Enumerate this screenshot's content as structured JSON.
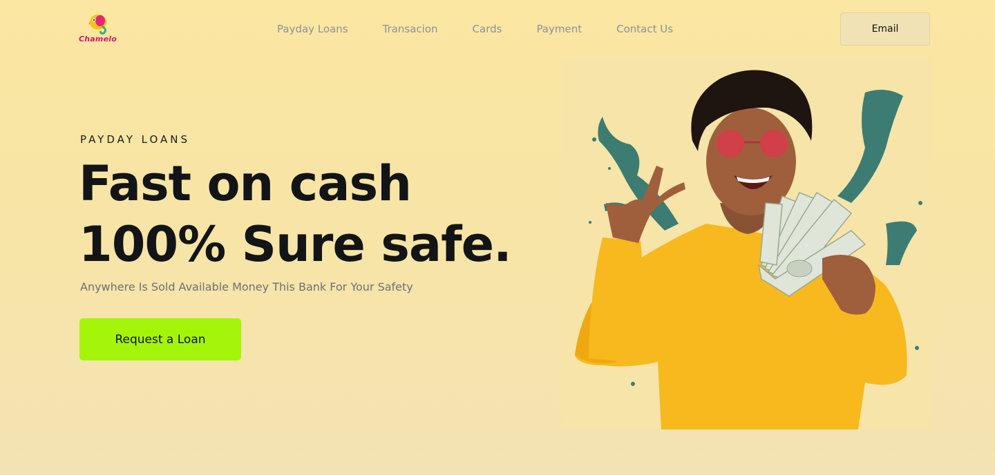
{
  "brand": {
    "name": "Chamelo"
  },
  "nav": {
    "links": [
      "Payday Loans",
      "Transacion",
      "Cards",
      "Payment",
      "Contact Us"
    ],
    "email_label": "Email"
  },
  "hero": {
    "eyebrow": "PAYDAY LOANS",
    "headline_line1": "Fast on cash",
    "headline_line2": "100% Sure safe.",
    "subtitle": "Anywhere Is Sold Available Money This Bank For Your Safety",
    "cta_label": "Request a Loan"
  },
  "colors": {
    "background": "#fbe7a1",
    "accent": "#a4f50a",
    "brand_pink": "#d6196b",
    "splash_teal": "#3d7c72",
    "sweater_yellow": "#f7b91e"
  },
  "icons": [
    "chameleon-logo-icon"
  ]
}
